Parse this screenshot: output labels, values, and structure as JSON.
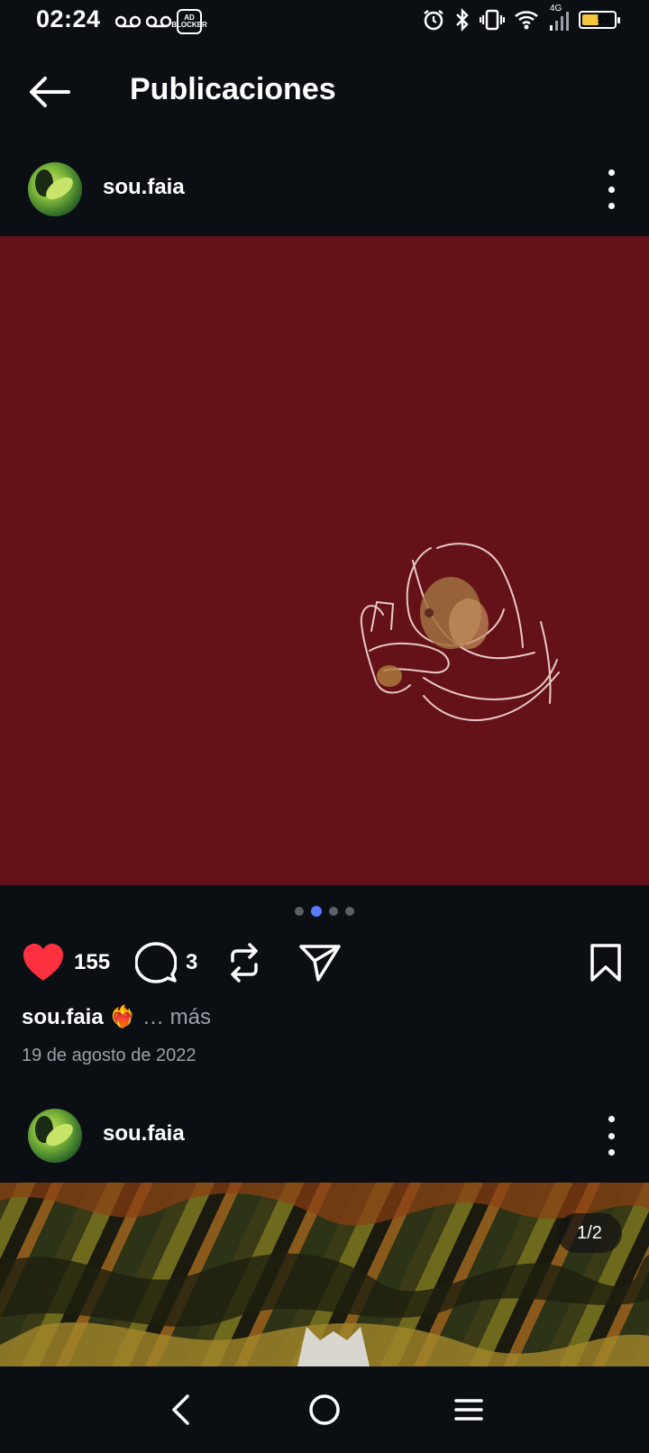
{
  "status_bar": {
    "time": "02:24",
    "adblock_label": "AD BLOCKER",
    "network": "4G",
    "battery_level": "52",
    "battery_fraction": 0.52,
    "icons": [
      "voicemail-icon",
      "voicemail-icon",
      "adblock-icon",
      "alarm-icon",
      "bluetooth-icon",
      "vibrate-icon",
      "wifi-icon",
      "signal-icon",
      "battery-icon"
    ]
  },
  "header": {
    "title": "Publicaciones"
  },
  "posts": [
    {
      "username": "sou.faia",
      "image_color": "#641117",
      "carousel_dots": 4,
      "carousel_active": 2,
      "likes": "155",
      "comments": "3",
      "caption_user": "sou.faia",
      "caption_emoji": "❤️‍🔥",
      "caption_more": "… más",
      "date": "19 de agosto de 2022"
    },
    {
      "username": "sou.faia",
      "image_counter": "1/2"
    }
  ],
  "colors": {
    "background": "#0b0f14",
    "like": "#ff3040",
    "dot_active": "#5b7bff"
  }
}
